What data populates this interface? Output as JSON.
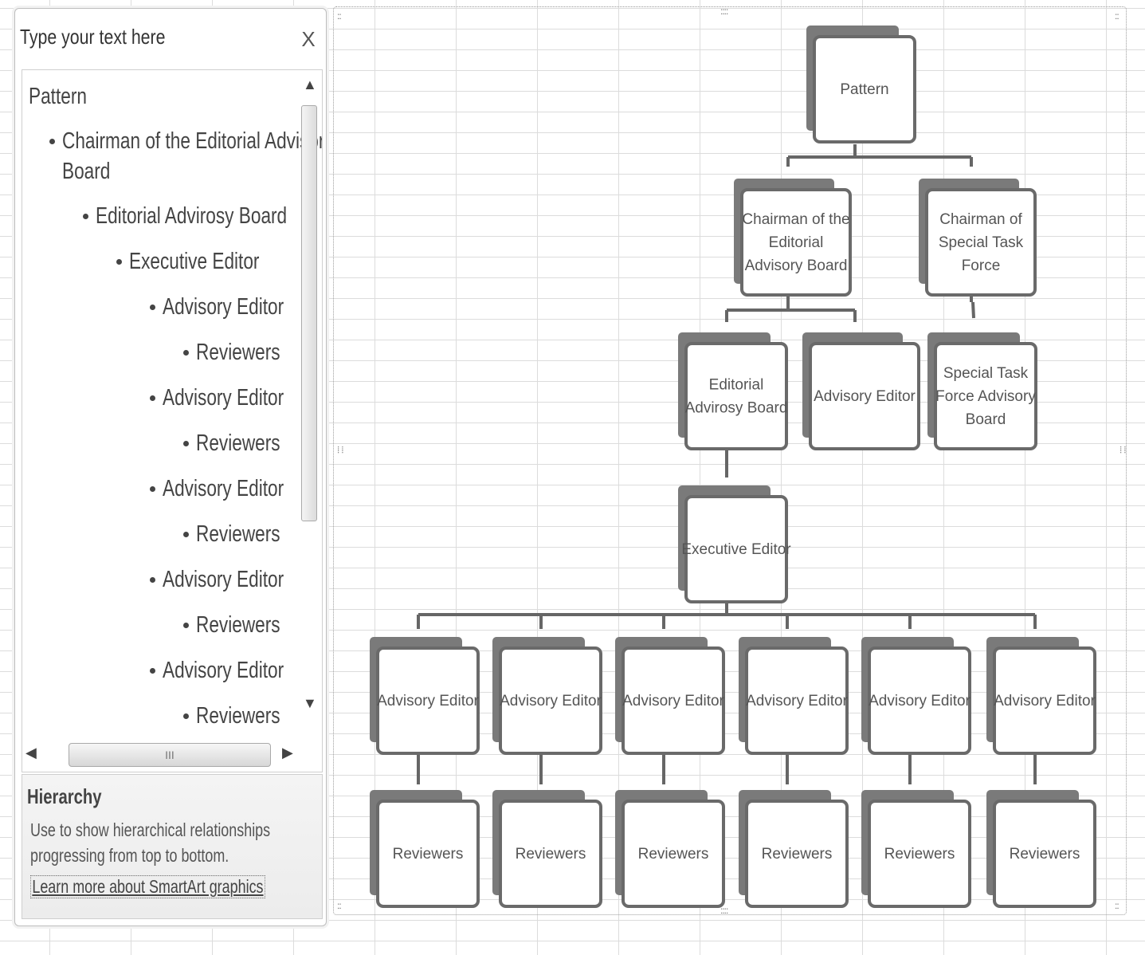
{
  "text_pane": {
    "title": "Type your text here",
    "close_label": "X",
    "items": [
      {
        "text": "Pattern",
        "level": 0
      },
      {
        "text": "Chairman of the Editorial Advisory",
        "cont": "Board",
        "level": 1
      },
      {
        "text": "Editorial Advirosy Board",
        "level": 2
      },
      {
        "text": "Executive Editor",
        "level": 3
      },
      {
        "text": "Advisory Editor",
        "level": 4
      },
      {
        "text": "Reviewers",
        "level": 5
      },
      {
        "text": "Advisory Editor",
        "level": 4
      },
      {
        "text": "Reviewers",
        "level": 5
      },
      {
        "text": "Advisory Editor",
        "level": 4
      },
      {
        "text": "Reviewers",
        "level": 5
      },
      {
        "text": "Advisory Editor",
        "level": 4
      },
      {
        "text": "Reviewers",
        "level": 5
      },
      {
        "text": "Advisory Editor",
        "level": 4
      },
      {
        "text": "Reviewers",
        "level": 5
      }
    ],
    "scroll_grip": "III"
  },
  "info_box": {
    "heading": "Hierarchy",
    "line1": "Use to show hierarchical relationships",
    "line2": "progressing from top to bottom.",
    "link": "Learn more about SmartArt graphics"
  },
  "diagram": {
    "root": "Pattern",
    "chairman_editorial": [
      "Chairman of the",
      "Editorial",
      "Advisory Board"
    ],
    "chairman_special": [
      "Chairman of",
      "Special Task",
      "Force"
    ],
    "editorial_board": [
      "Editorial",
      "Advirosy Board"
    ],
    "advisory_editor_top": "Advisory Editor",
    "special_board": [
      "Special Task",
      "Force Advisory",
      "Board"
    ],
    "executive_editor": "Executive Editor",
    "advisory_editors": [
      "Advisory Editor",
      "Advisory Editor",
      "Advisory Editor",
      "Advisory Editor",
      "Advisory Editor",
      "Advisory Editor"
    ],
    "reviewers": [
      "Reviewers",
      "Reviewers",
      "Reviewers",
      "Reviewers",
      "Reviewers",
      "Reviewers"
    ]
  }
}
